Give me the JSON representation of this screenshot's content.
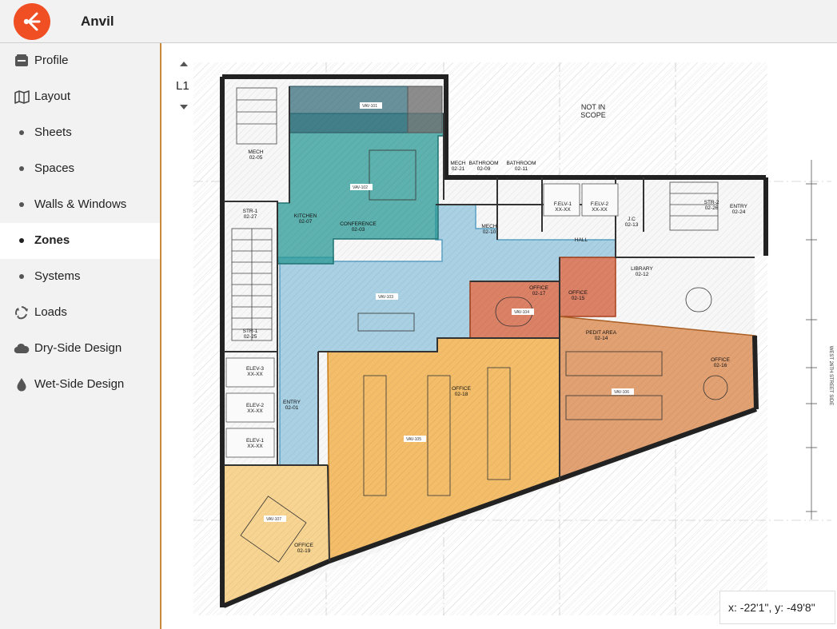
{
  "app": {
    "title": "Anvil",
    "accent": "#f04e23"
  },
  "sidebar": {
    "items": [
      {
        "label": "Profile",
        "icon": "profile-icon"
      },
      {
        "label": "Layout",
        "icon": "map-icon"
      },
      {
        "label": "Sheets",
        "icon": "dot-icon"
      },
      {
        "label": "Spaces",
        "icon": "dot-icon"
      },
      {
        "label": "Walls & Windows",
        "icon": "dot-icon"
      },
      {
        "label": "Zones",
        "icon": "dot-icon",
        "active": true
      },
      {
        "label": "Systems",
        "icon": "dot-icon"
      },
      {
        "label": "Loads",
        "icon": "recycle-icon"
      },
      {
        "label": "Dry-Side Design",
        "icon": "cloud-icon"
      },
      {
        "label": "Wet-Side Design",
        "icon": "drop-icon"
      }
    ]
  },
  "floor": {
    "current": "L1"
  },
  "plan": {
    "not_in_scope": [
      "NOT IN",
      "SCOPE"
    ],
    "street": "WEST 26TH STREET SIDE",
    "rooms": [
      {
        "name": "MECH",
        "num": "02-05"
      },
      {
        "name": "STR-1",
        "num": "02-27"
      },
      {
        "name": "KITCHEN",
        "num": "02-07"
      },
      {
        "name": "CONFERENCE",
        "num": "02-03"
      },
      {
        "name": "MECH",
        "num": "02-21"
      },
      {
        "name": "BATHROOM",
        "num": "02-09"
      },
      {
        "name": "BATHROOM",
        "num": "02-11"
      },
      {
        "name": "MECH",
        "num": "02-10"
      },
      {
        "name": "F.ELV-1",
        "num": "XX-XX"
      },
      {
        "name": "F.ELV-2",
        "num": "XX-XX"
      },
      {
        "name": "J.C",
        "num": "02-13"
      },
      {
        "name": "STR-2",
        "num": "02-26"
      },
      {
        "name": "ENTRY",
        "num": "02-24"
      },
      {
        "name": "HALL",
        "num": ""
      },
      {
        "name": "LIBRARY",
        "num": "02-12"
      },
      {
        "name": "OFFICE",
        "num": "02-17"
      },
      {
        "name": "OFFICE",
        "num": "02-15"
      },
      {
        "name": "STR-1",
        "num": "02-25"
      },
      {
        "name": "ENTRY",
        "num": "02-01"
      },
      {
        "name": "ELEV-3",
        "num": "XX-XX"
      },
      {
        "name": "ELEV-2",
        "num": "XX-XX"
      },
      {
        "name": "ELEV-1",
        "num": "XX-XX"
      },
      {
        "name": "OFFICE",
        "num": "02-18"
      },
      {
        "name": "OFFICE",
        "num": "02-16"
      },
      {
        "name": "PEDIT AREA",
        "num": "02-14"
      },
      {
        "name": "OFFICE",
        "num": "02-19"
      }
    ],
    "vav_tags": [
      "VAV-101",
      "VAV-102",
      "VAV-103",
      "VAV-104",
      "VAV-105",
      "VAV-106",
      "VAV-107"
    ],
    "zone_colors": {
      "conference": "#2a9a96",
      "open": "#8fc3dc",
      "office": "#d25a35",
      "orange": "#f2a93b",
      "pedit": "#d98445",
      "southwest": "#f6c565",
      "dark": "#3a6f7c",
      "gray": "#707070"
    }
  },
  "coordinates": {
    "readout": "x: -22'1\", y: -49'8\""
  }
}
